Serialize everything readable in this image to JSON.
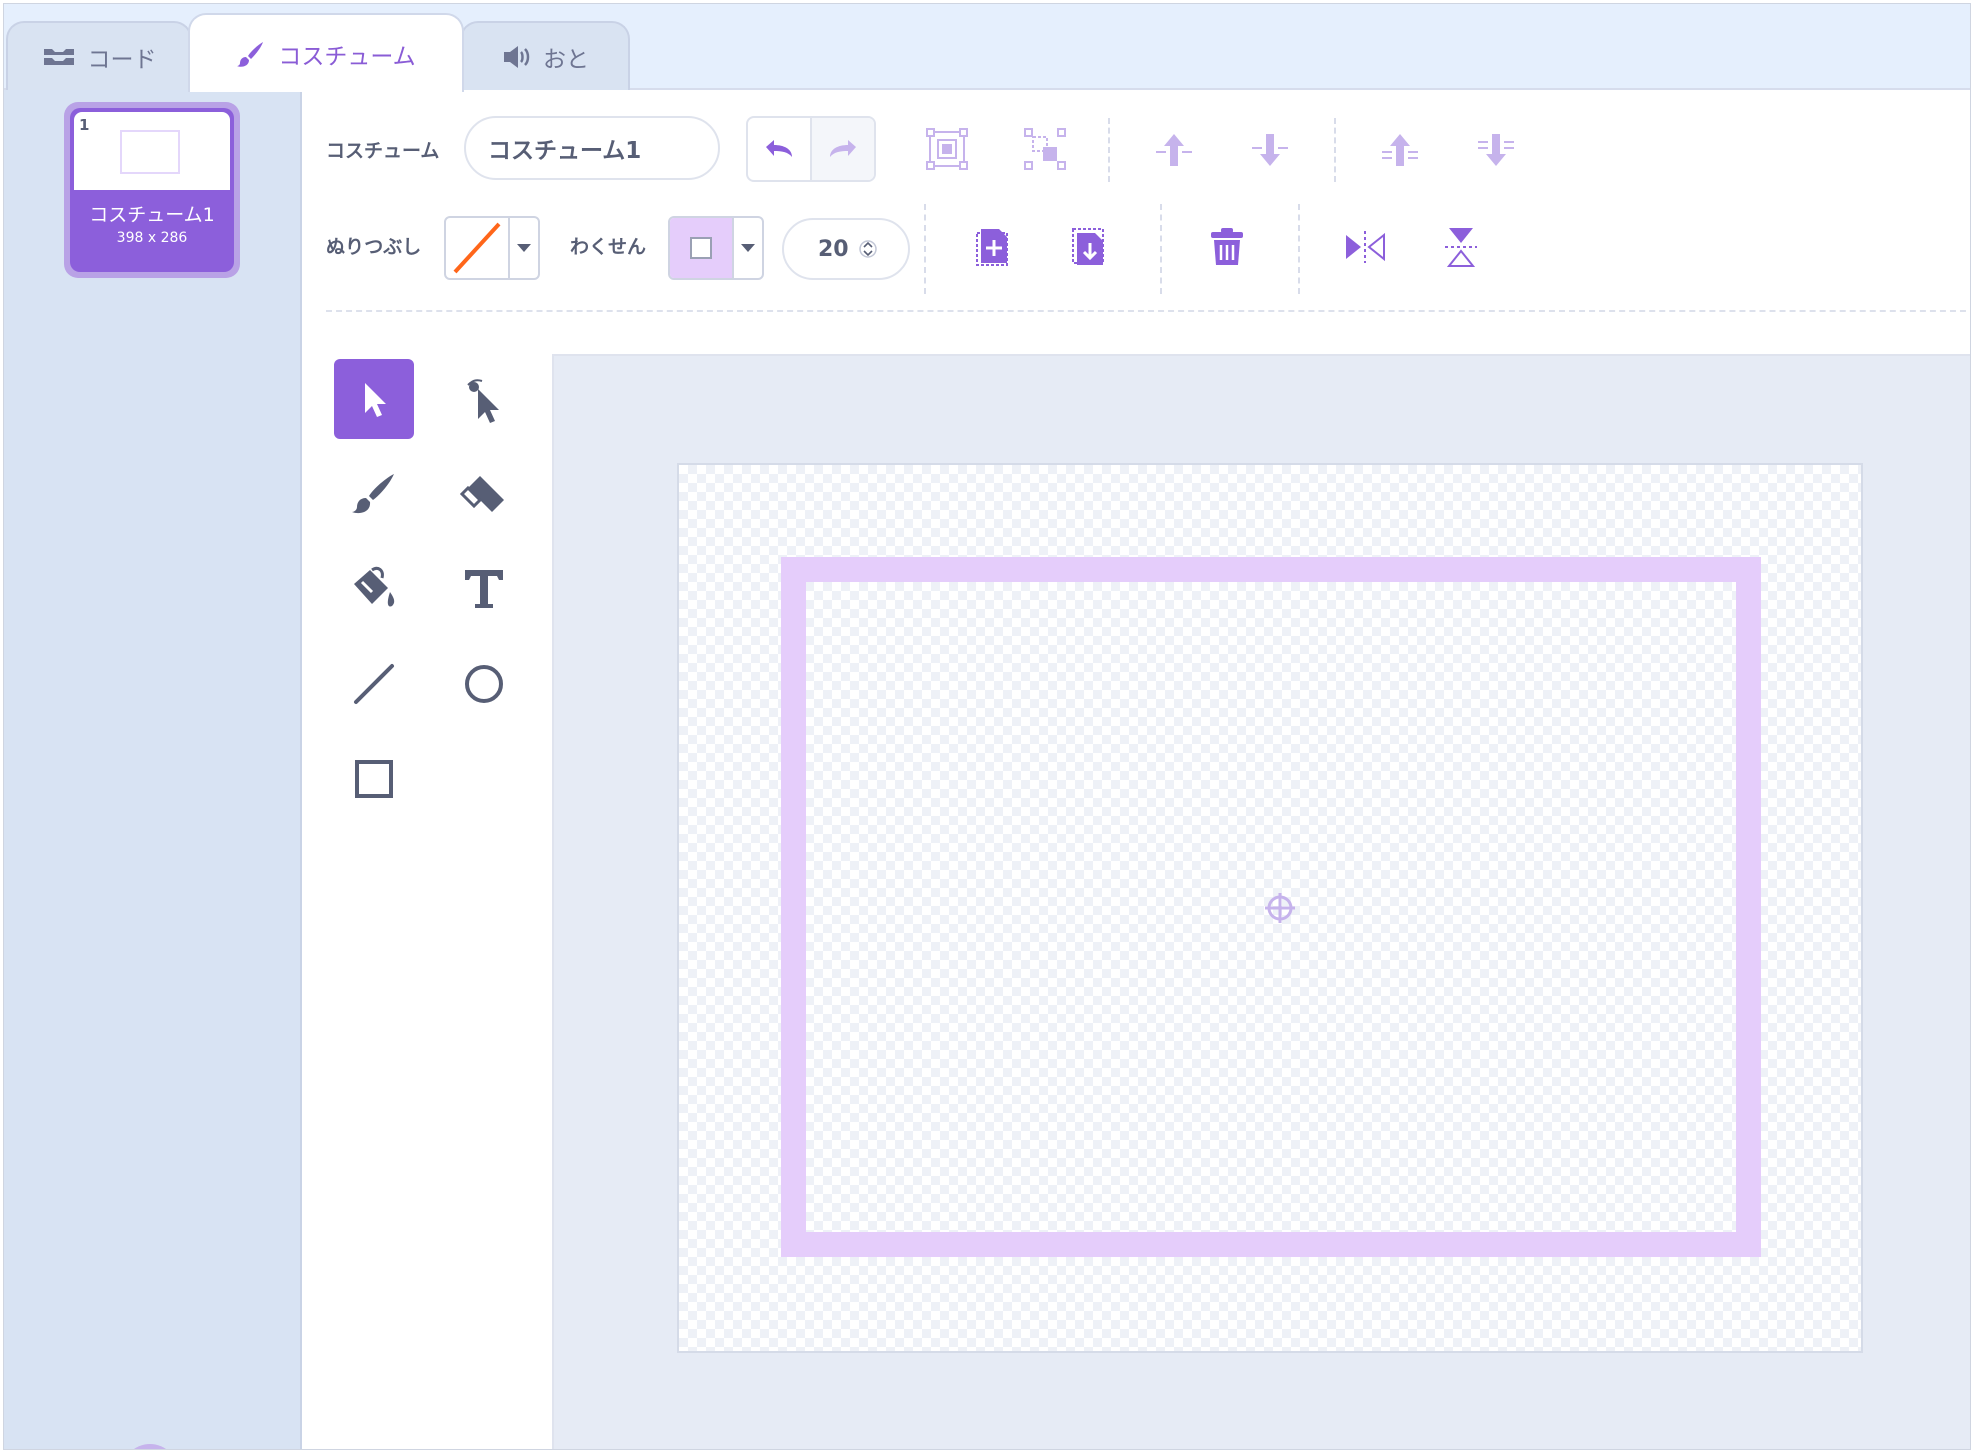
{
  "tabs": {
    "code": "コード",
    "costume": "コスチューム",
    "sound": "おと"
  },
  "costume_list": {
    "items": [
      {
        "index": "1",
        "name": "コスチューム1",
        "size": "398 x 286"
      }
    ]
  },
  "toolbar": {
    "costume_label": "コスチューム",
    "costume_name": "コスチューム1",
    "fill_label": "ぬりつぶし",
    "outline_label": "わくせん",
    "outline_size": "20"
  },
  "colors": {
    "accent": "#8c5fdb",
    "fill_none_slash": "#ff661a",
    "outline_swatch": "#e5cdfb",
    "shape_outline": "#e5cdfb"
  },
  "icons": {
    "toolbar": [
      "undo-icon",
      "redo-icon",
      "group-icon",
      "ungroup-icon",
      "forward-icon",
      "backward-icon",
      "front-icon",
      "back-icon",
      "copy-icon",
      "paste-icon",
      "delete-icon",
      "flip-horizontal-icon",
      "flip-vertical-icon"
    ],
    "tools": [
      "select-tool-icon",
      "reshape-tool-icon",
      "brush-tool-icon",
      "eraser-tool-icon",
      "fill-tool-icon",
      "text-tool-icon",
      "line-tool-icon",
      "circle-tool-icon",
      "rectangle-tool-icon"
    ]
  }
}
